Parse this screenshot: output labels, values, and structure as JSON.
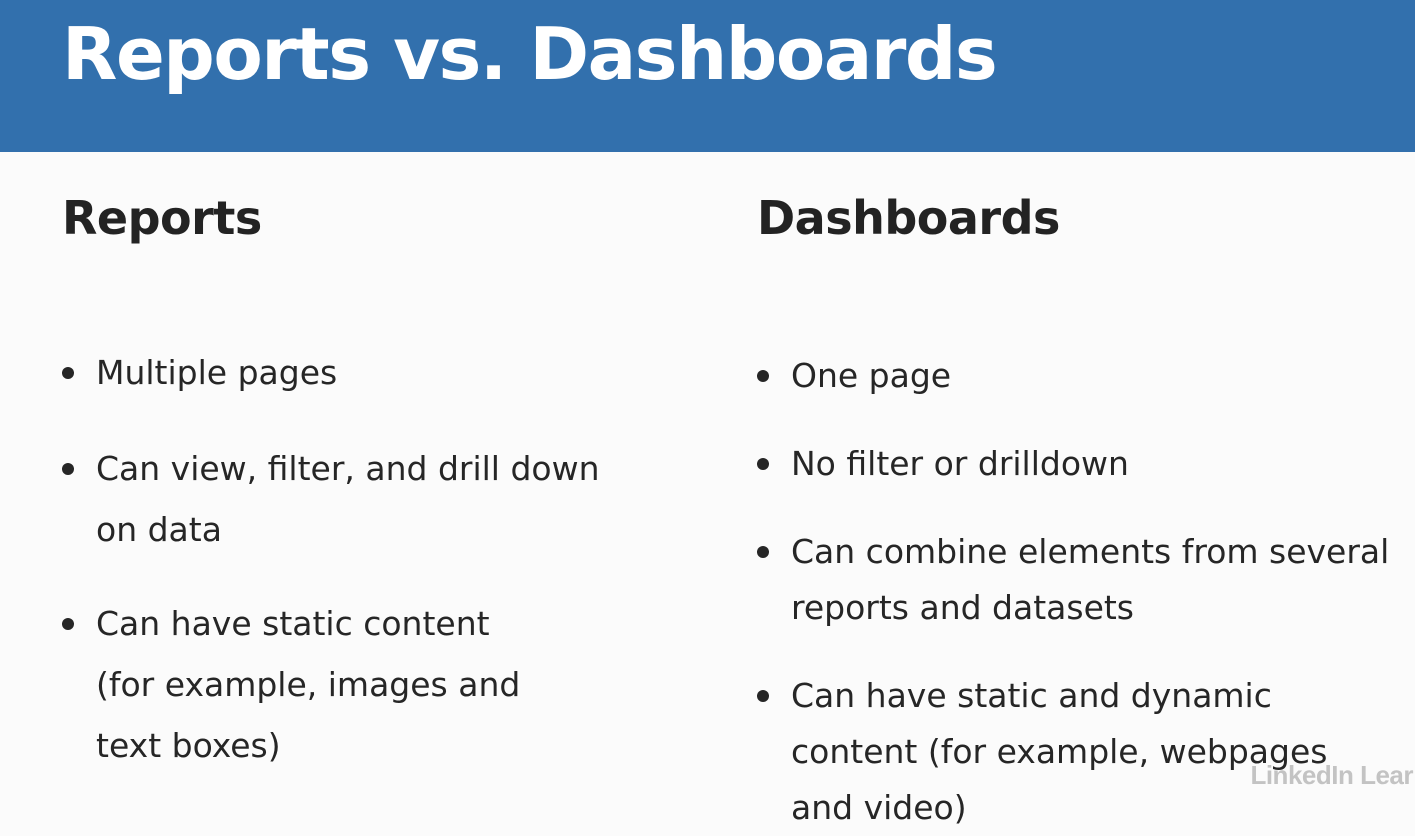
{
  "slide": {
    "title": "Reports vs. Dashboards"
  },
  "reports": {
    "heading": "Reports",
    "items": [
      "Multiple pages",
      "Can view, filter, and drill down on data",
      "Can have static content (for example, images and text boxes)"
    ]
  },
  "dashboards": {
    "heading": "Dashboards",
    "items": [
      "One page",
      "No filter or drilldown",
      "Can combine elements from several reports and datasets",
      "Can have static and dynamic content (for example, webpages and video)"
    ]
  },
  "watermark": {
    "text": "LinkedIn Lear"
  },
  "colors": {
    "title_bar": "#3270ad",
    "title_text": "#ffffff",
    "body_text": "#262626",
    "background": "#fbfbfb"
  }
}
